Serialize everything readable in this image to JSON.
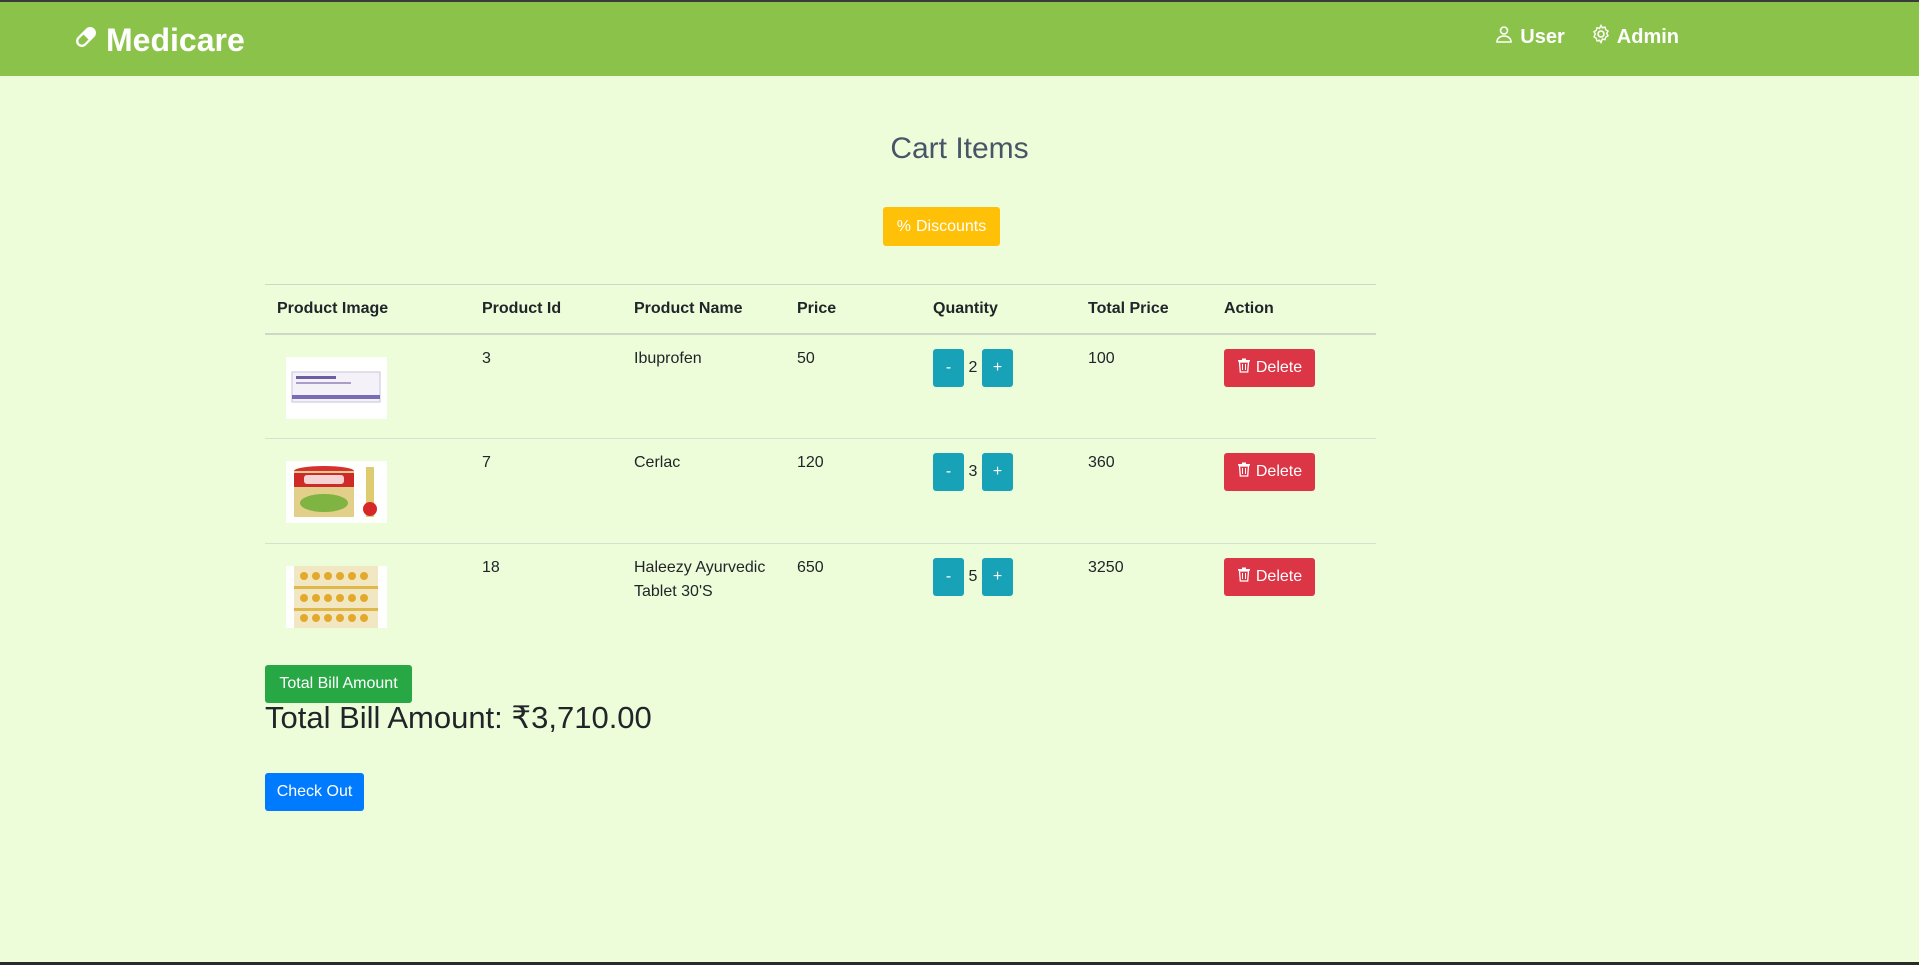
{
  "navbar": {
    "brand": "Medicare",
    "links": [
      {
        "label": "User",
        "icon": "user-icon"
      },
      {
        "label": "Admin",
        "icon": "gear-icon"
      }
    ],
    "color": "#8bc34a"
  },
  "page": {
    "title": "Cart Items",
    "discount_label": "Discounts"
  },
  "table": {
    "headers": [
      "Product Image",
      "Product Id",
      "Product Name",
      "Price",
      "Quantity",
      "Total Price",
      "Action"
    ],
    "rows": [
      {
        "id": "3",
        "name": "Ibuprofen",
        "price": "50",
        "qty": "2",
        "total": "100",
        "action": "Delete"
      },
      {
        "id": "7",
        "name": "Cerlac",
        "price": "120",
        "qty": "3",
        "total": "360",
        "action": "Delete"
      },
      {
        "id": "18",
        "name": "Haleezy Ayurvedic Tablet 30'S",
        "price": "650",
        "qty": "5",
        "total": "3250",
        "action": "Delete"
      }
    ],
    "minus_label": "-",
    "plus_label": "+"
  },
  "summary": {
    "total_button": "Total Bill Amount",
    "total_text": "Total Bill Amount: ₹3,710.00",
    "checkout": "Check Out"
  },
  "colors": {
    "background": "#edfdd9",
    "discount": "#ffc107",
    "qty": "#17a2b8",
    "delete": "#dc3545",
    "total": "#28a745",
    "checkout": "#007bff"
  }
}
